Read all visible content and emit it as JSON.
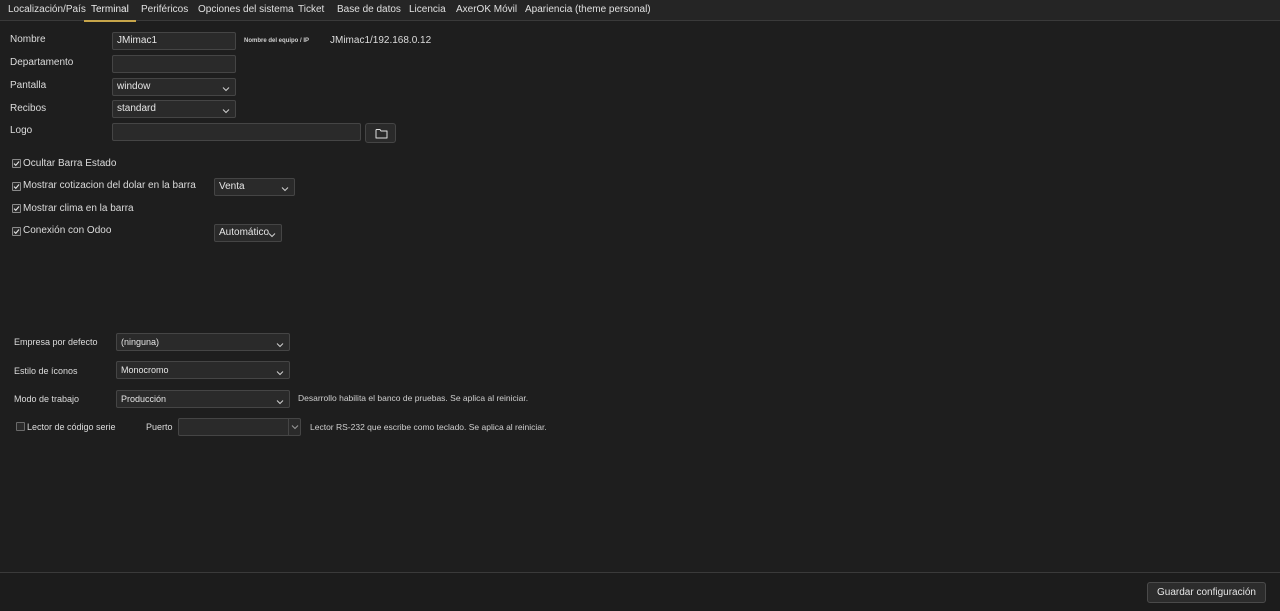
{
  "tabs": [
    {
      "label": "Localización/País",
      "active": false
    },
    {
      "label": "Terminal",
      "active": true
    },
    {
      "label": "Periféricos",
      "active": false
    },
    {
      "label": "Opciones del sistema",
      "active": false
    },
    {
      "label": "Ticket",
      "active": false
    },
    {
      "label": "Base de datos",
      "active": false
    },
    {
      "label": "Licencia",
      "active": false
    },
    {
      "label": "AxerOK Móvil",
      "active": false
    },
    {
      "label": "Apariencia (theme personal)",
      "active": false
    }
  ],
  "terminal": {
    "nombre_label": "Nombre",
    "nombre_value": "JMimac1",
    "hostname_label": "Nombre del equipo / IP",
    "hostname_value": "JMimac1/192.168.0.12",
    "departamento_label": "Departamento",
    "departamento_value": "",
    "pantalla_label": "Pantalla",
    "pantalla_value": "window",
    "recibos_label": "Recibos",
    "recibos_value": "standard",
    "logo_label": "Logo",
    "logo_value": ""
  },
  "options": {
    "ocultar_barra": {
      "label": "Ocultar Barra Estado",
      "checked": true
    },
    "cotizacion_dolar": {
      "label": "Mostrar cotizacion del dolar en la barra",
      "checked": true,
      "select_value": "Venta"
    },
    "clima": {
      "label": "Mostrar clima en la barra",
      "checked": true
    },
    "odoo": {
      "label": "Conexión con Odoo",
      "checked": true,
      "select_value": "Automático"
    }
  },
  "advanced": {
    "empresa_label": "Empresa por defecto",
    "empresa_value": "(ninguna)",
    "iconos_label": "Estilo de íconos",
    "iconos_value": "Monocromo",
    "modo_label": "Modo de trabajo",
    "modo_value": "Producción",
    "modo_hint": "Desarrollo habilita el banco de pruebas. Se aplica al reiniciar.",
    "lector_label": "Lector de código serie",
    "lector_checked": false,
    "puerto_label": "Puerto",
    "puerto_value": "",
    "lector_hint": "Lector RS-232 que escribe como teclado. Se aplica al reiniciar."
  },
  "footer": {
    "save_label": "Guardar configuración"
  },
  "colors": {
    "background": "#1e1e1e",
    "tab_accent": "#c7a54a",
    "field_bg": "#2a2a2a",
    "border": "#454545"
  }
}
